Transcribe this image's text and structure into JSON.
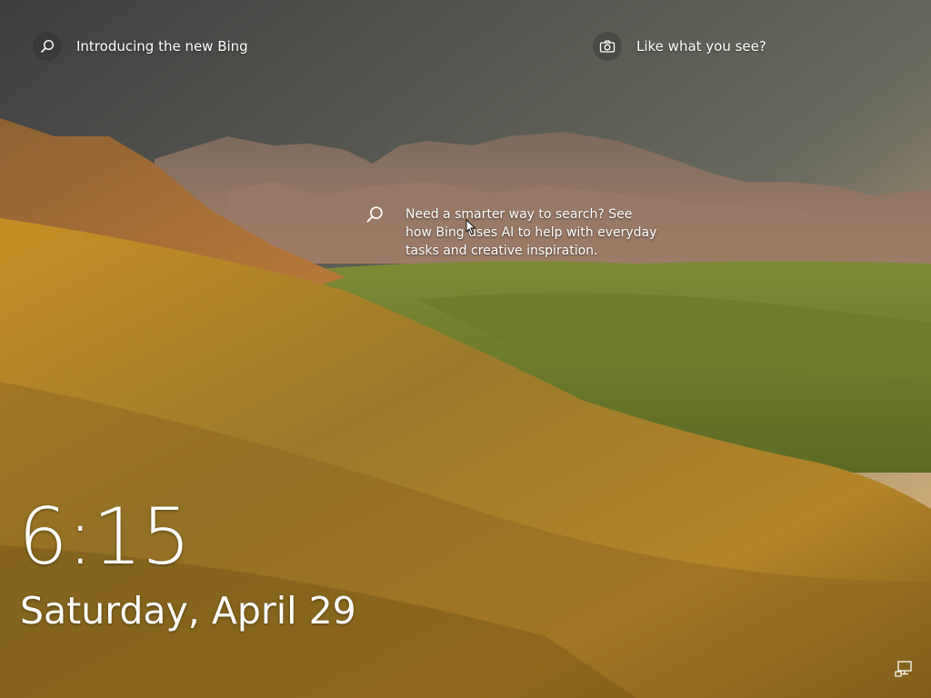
{
  "lockscreen": {
    "spotlight_search_label": "Introducing the new Bing",
    "spotlight_photo_label": "Like what you see?",
    "tooltip_text": "Need a smarter way to search? See how Bing uses AI to help with everyday tasks and creative inspiration.",
    "time": "6:15",
    "date": "Saturday, April 29"
  },
  "icons": {
    "search": "search-icon",
    "camera": "camera-icon",
    "network": "network-icon",
    "cursor": "mouse-cursor"
  }
}
